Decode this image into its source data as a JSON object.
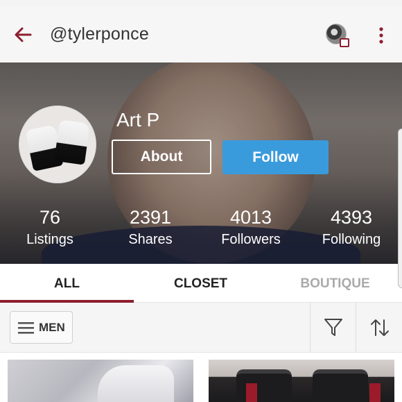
{
  "header": {
    "handle": "@tylerponce"
  },
  "profile": {
    "name": "Art P",
    "about_label": "About",
    "follow_label": "Follow"
  },
  "stats": [
    {
      "value": "76",
      "label": "Listings"
    },
    {
      "value": "2391",
      "label": "Shares"
    },
    {
      "value": "4013",
      "label": "Followers"
    },
    {
      "value": "4393",
      "label": "Following"
    }
  ],
  "tabs": [
    {
      "label": "ALL",
      "active": true
    },
    {
      "label": "CLOSET",
      "active": false
    },
    {
      "label": "BOUTIQUE",
      "active": false
    }
  ],
  "filters": {
    "department_label": "MEN"
  },
  "colors": {
    "accent": "#8c1f2f",
    "follow_button": "#3a9bdc",
    "appbar_bg": "#f7f6f6"
  },
  "icons": {
    "back": "back-arrow-icon",
    "more": "more-vertical-icon",
    "menu": "menu-lines-icon",
    "filter": "filter-funnel-icon",
    "sort": "sort-arrows-icon"
  }
}
